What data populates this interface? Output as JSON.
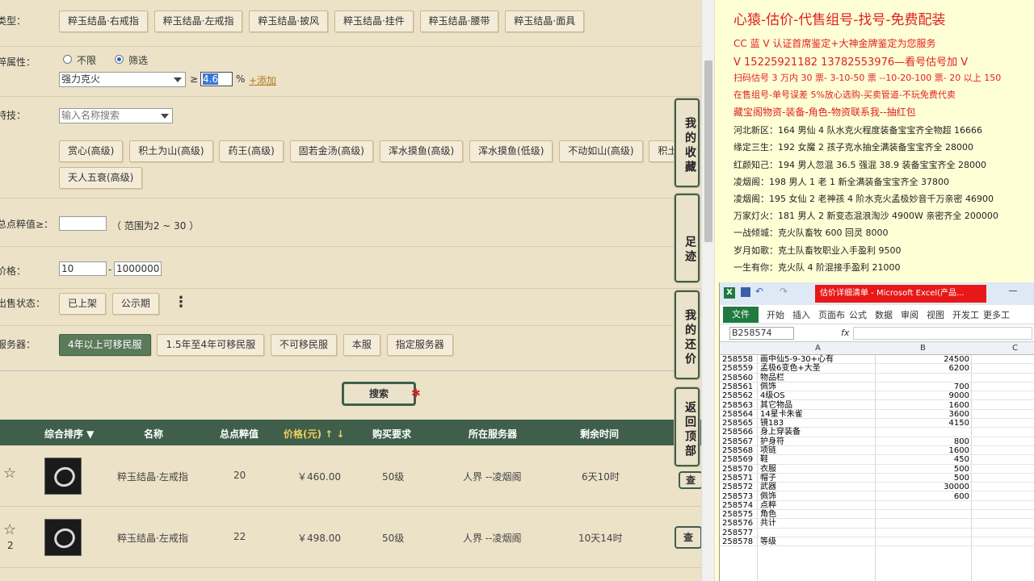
{
  "filters": {
    "type_label": "类型：",
    "type_buttons": [
      "粹玉结晶·右戒指",
      "粹玉结晶·左戒指",
      "粹玉结晶·披风",
      "粹玉结晶·挂件",
      "粹玉结晶·腰带",
      "粹玉结晶·面具"
    ],
    "attr_label": "粹属性：",
    "radio_unlimited": "不限",
    "radio_filter": "筛选",
    "attr_select": "强力克火",
    "attr_ge": "≥",
    "attr_value": "4.6",
    "attr_pct": "%",
    "attr_add": "+添加",
    "skill_label": "特技：",
    "skill_placeholder": "输入名称搜索",
    "skill_buttons_row1": [
      "赏心(高级)",
      "积土为山(高级)",
      "药王(高级)",
      "固若金汤(高级)",
      "浑水摸鱼(高级)",
      "浑水摸鱼(低级)",
      "不动如山(高级)",
      "积土"
    ],
    "skill_buttons_row2": [
      "天人五衰(高级)"
    ],
    "total_label": "总点粹值≥：",
    "total_hint": "（ 范围为2 ~ 30 ）",
    "price_label": "价格：",
    "price_min": "10",
    "price_dash": "-",
    "price_max": "1000000",
    "sale_label": "出售状态：",
    "sale_buttons": [
      "已上架",
      "公示期"
    ],
    "more_icon": "⋮",
    "server_label": "服务器：",
    "server_buttons": [
      "4年以上可移民服",
      "1.5年至4年可移民服",
      "不可移民服",
      "本服",
      "指定服务器"
    ],
    "search_button": "搜索"
  },
  "table": {
    "headers": [
      "综合排序 ▼",
      "名称",
      "总点粹值",
      "价格(元) ↑ ↓",
      "购买要求",
      "所在服务器",
      "剩余时间"
    ],
    "rows": [
      {
        "star_count": "",
        "name": "粹玉结晶·左戒指",
        "total": "20",
        "price": "￥460.00",
        "level": "50级",
        "server": "人界 --凌烟阁",
        "remain": "6天10时",
        "action": "查"
      },
      {
        "star_count": "2",
        "name": "粹玉结晶·左戒指",
        "total": "22",
        "price": "￥498.00",
        "level": "50级",
        "server": "人界 --凌烟阁",
        "remain": "10天14时",
        "action": "查"
      }
    ]
  },
  "side_buttons": [
    "我的收藏",
    "足迹",
    "我的还价",
    "返回顶部"
  ],
  "promo": {
    "title": "心猿-估价-代售组号-找号-免费配装",
    "lines_red": [
      "CC 蓝 V 认证首席鉴定+大神金牌鉴定为您服务",
      "V 15225921182     13782553976—看号估号加 V",
      "扫码估号 3 万内 30 票- 3-10-50 票  --10-20-100 票- 20 以上 150",
      "在售组号-单号误差 5%放心选购-买卖管道-不玩免费代卖",
      "藏宝阁物资-装备-角色-物资联系我--抽红包"
    ],
    "lines_black": [
      "河北新区：164 男仙 4 队水克火程度装备宝宝齐全物超 16666",
      "缘定三生：192 女魔 2 孩子克水抽全满装备宝宝齐全 28000",
      "红颜知己：194 男人忽混 36.5 强混 38.9 装备宝宝齐全 28000",
      "凌烟阁：198 男人 1 老 1 新全满装备宝宝齐全 37800",
      "凌烟阁：195 女仙 2 老神孩 4 阶水克火孟极妙音千万亲密 46900",
      "万家灯火：181 男人 2 新变态混浪淘沙 4900W 亲密齐全 200000",
      "一战倾城：克火队畜牧 600 回灵 8000",
      "岁月如歌：克土队畜牧职业入手盈利 9500",
      "一生有你：克火队 4 阶混接手盈利 21000"
    ]
  },
  "excel": {
    "title": "估价详细清单 - Microsoft Excel(产品...",
    "tabs": [
      "文件",
      "开始",
      "插入",
      "页面布",
      "公式",
      "数据",
      "审阅",
      "视图",
      "开发工",
      "更多工"
    ],
    "name_box": "B258574",
    "fx": "fx",
    "col_headers": [
      "A",
      "B",
      "C"
    ],
    "rows": [
      [
        "258558",
        "画中仙5-9-30+心有",
        "24500"
      ],
      [
        "258559",
        "孟极6变色+大圣",
        "6200"
      ],
      [
        "258560",
        "物品栏",
        ""
      ],
      [
        "258561",
        "佩饰",
        "700"
      ],
      [
        "258562",
        "4级OS",
        "9000"
      ],
      [
        "258563",
        "其它物品",
        "1600"
      ],
      [
        "258564",
        "14星卡朱雀",
        "3600"
      ],
      [
        "258565",
        "镜183",
        "4150"
      ],
      [
        "258566",
        "身上穿装备",
        ""
      ],
      [
        "258567",
        "护身符",
        "800"
      ],
      [
        "258568",
        "项链",
        "1600"
      ],
      [
        "258569",
        "鞋",
        "450"
      ],
      [
        "258570",
        "衣服",
        "500"
      ],
      [
        "258571",
        "帽子",
        "500"
      ],
      [
        "258572",
        "武器",
        "30000"
      ],
      [
        "258573",
        "佩饰",
        "600"
      ],
      [
        "258574",
        "点粹",
        ""
      ],
      [
        "258575",
        "角色",
        ""
      ],
      [
        "258576",
        "共计",
        ""
      ],
      [
        "258577",
        "",
        ""
      ],
      [
        "258578",
        "等级",
        ""
      ]
    ]
  }
}
